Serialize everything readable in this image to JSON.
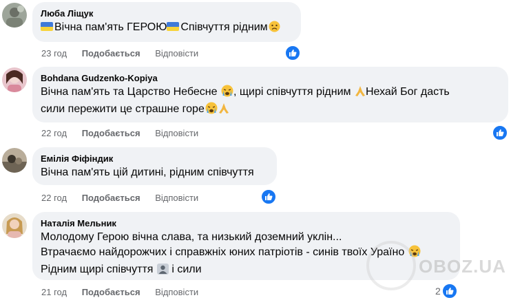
{
  "comments": [
    {
      "author": "Люба Ліщук",
      "lines": [
        "Вічна пам'ять ГЕРОЮ",
        "Співчуття рідним"
      ],
      "time": "23 год",
      "like_label": "Подобається",
      "reply_label": "Відповісти"
    },
    {
      "author": "Bohdana Gudzenko-Kopiya",
      "lines": [
        "Вічна пам'ять та Царство Небесне",
        ", щирі співчуття рідним",
        "Нехай Бог дасть",
        "сили пережити це страшне горе"
      ],
      "time": "22 год",
      "like_label": "Подобається",
      "reply_label": "Відповісти"
    },
    {
      "author": "Емілія Фіфіндик",
      "lines": [
        "Вічна пам'ять цій дитині, рідним співчуття"
      ],
      "time": "22 год",
      "like_label": "Подобається",
      "reply_label": "Відповісти"
    },
    {
      "author": "Наталія Мельник",
      "lines": [
        "Молодому Герою вічна слава, та низький доземний уклін...",
        "Втрачаємо найдорожчих і справжніх юних патріотів - синів твоїх Ураїно",
        "Рідним щирі співчуття",
        "і сили"
      ],
      "time": "21 год",
      "like_label": "Подобається",
      "reply_label": "Відповісти",
      "reaction_count": "2"
    }
  ],
  "watermark": "OBOZ.UA",
  "colors": {
    "bubble": "#f0f2f5",
    "like_blue": "#1877f2",
    "meta_gray": "#65676b"
  },
  "icons": [
    "ukraine-flag-icon",
    "sad-face-icon",
    "crying-face-icon",
    "praying-hands-icon",
    "like-thumb-icon"
  ]
}
